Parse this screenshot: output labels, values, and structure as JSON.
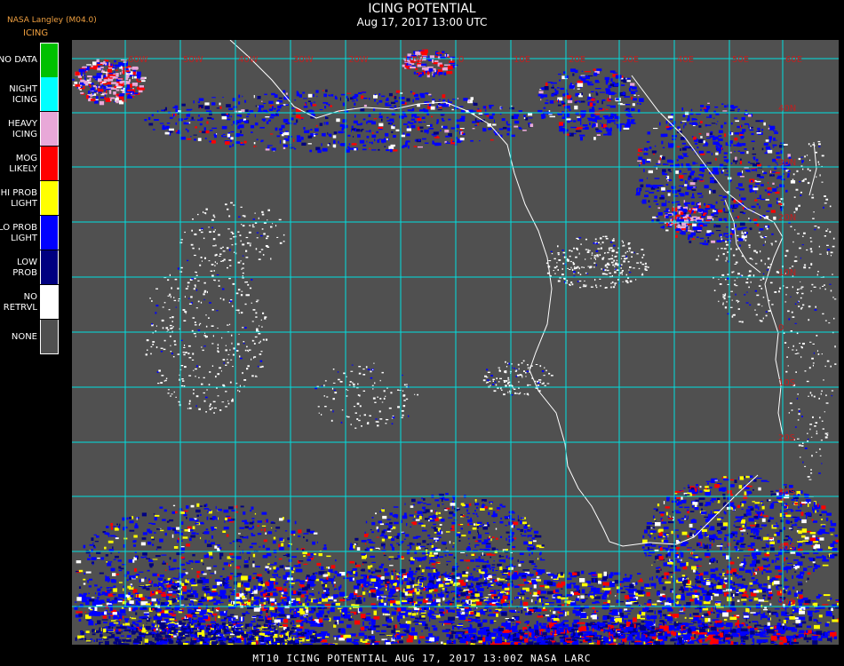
{
  "header": {
    "title": "ICING POTENTIAL",
    "datetime": "Aug 17, 2017 13:00 UTC",
    "producer": "NASA Langley (M04.0)",
    "product": "ICING"
  },
  "legend": [
    {
      "lines": [
        "NO DATA"
      ],
      "color": "#00c000"
    },
    {
      "lines": [
        "NIGHT",
        "ICING"
      ],
      "color": "#00ffff"
    },
    {
      "lines": [
        "HEAVY",
        "ICING"
      ],
      "color": "#e8a8d8"
    },
    {
      "lines": [
        "MOG",
        "LIKELY"
      ],
      "color": "#ff0000"
    },
    {
      "lines": [
        "HI PROB",
        "LIGHT"
      ],
      "color": "#ffff00"
    },
    {
      "lines": [
        "LO PROB",
        "LIGHT"
      ],
      "color": "#0000ff"
    },
    {
      "lines": [
        "LOW",
        "PROB"
      ],
      "color": "#000080"
    },
    {
      "lines": [
        "NO",
        "RETRVL"
      ],
      "color": "#ffffff"
    },
    {
      "lines": [
        "NONE"
      ],
      "color": "#505050"
    }
  ],
  "colors": {
    "background": "#000000",
    "map_fill": "#505050",
    "grid": "#00e0e0",
    "coast": "#ffffff",
    "grid_label": "#c02020"
  },
  "grid_labels": {
    "top": [
      "60W",
      "50W",
      "40W",
      "30W",
      "20W",
      "10W",
      "0",
      "10E",
      "20E",
      "30E",
      "40E",
      "50E",
      "60E"
    ],
    "right": [
      "40N",
      "30N",
      "20N",
      "10N",
      "0",
      "10S",
      "20S",
      "30S",
      "40S",
      "50S"
    ]
  },
  "footer": "MT10  ICING POTENTIAL   AUG 17, 2017 13:00Z   NASA LARC"
}
